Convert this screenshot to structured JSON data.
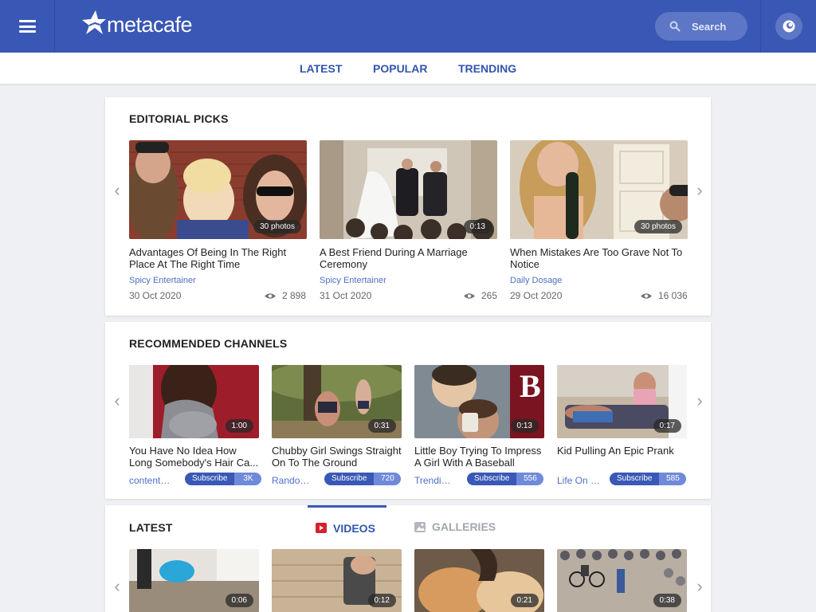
{
  "header": {
    "logo_text": "metacafe",
    "search_placeholder": "Search"
  },
  "nav": {
    "items": [
      "LATEST",
      "POPULAR",
      "TRENDING"
    ]
  },
  "editorial": {
    "title": "EDITORIAL PICKS",
    "cards": [
      {
        "title": "Advantages Of Being In The Right Place At The Right Time",
        "channel": "Spicy Entertainer",
        "date": "30 Oct 2020",
        "views": "2 898",
        "badge": "30 photos"
      },
      {
        "title": "A Best Friend During A Marriage Ceremony",
        "channel": "Spicy Entertainer",
        "date": "31 Oct 2020",
        "views": "265",
        "badge": "0:13"
      },
      {
        "title": "When Mistakes Are Too Grave Not To Notice",
        "channel": "Daily Dosage",
        "date": "29 Oct 2020",
        "views": "16 036",
        "badge": "30 photos"
      }
    ]
  },
  "channels": {
    "title": "RECOMMENDED CHANNELS",
    "subscribe_label": "Subscribe",
    "cards": [
      {
        "title": "You Have No Idea How Long Somebody's Hair Ca...",
        "channel": "content…",
        "count": "3K",
        "badge": "1:00"
      },
      {
        "title": "Chubby Girl Swings Straight On To The Ground",
        "channel": "Rando…",
        "count": "720",
        "badge": "0:31"
      },
      {
        "title": "Little Boy Trying To Impress A Girl With A Baseball",
        "channel": "Trendin…",
        "count": "556",
        "badge": "0:13"
      },
      {
        "title": "Kid Pulling An Epic Prank",
        "channel": "Life On …",
        "count": "585",
        "badge": "0:17"
      }
    ]
  },
  "latest": {
    "title": "LATEST",
    "tabs": [
      "VIDEOS",
      "GALLERIES"
    ],
    "cards": [
      {
        "badge": "0:06"
      },
      {
        "badge": "0:12"
      },
      {
        "badge": "0:21"
      },
      {
        "badge": "0:38"
      }
    ]
  },
  "colors": {
    "brand": "#3957b4",
    "link": "#4d6fc7",
    "subscribe": "#3a58b6"
  }
}
